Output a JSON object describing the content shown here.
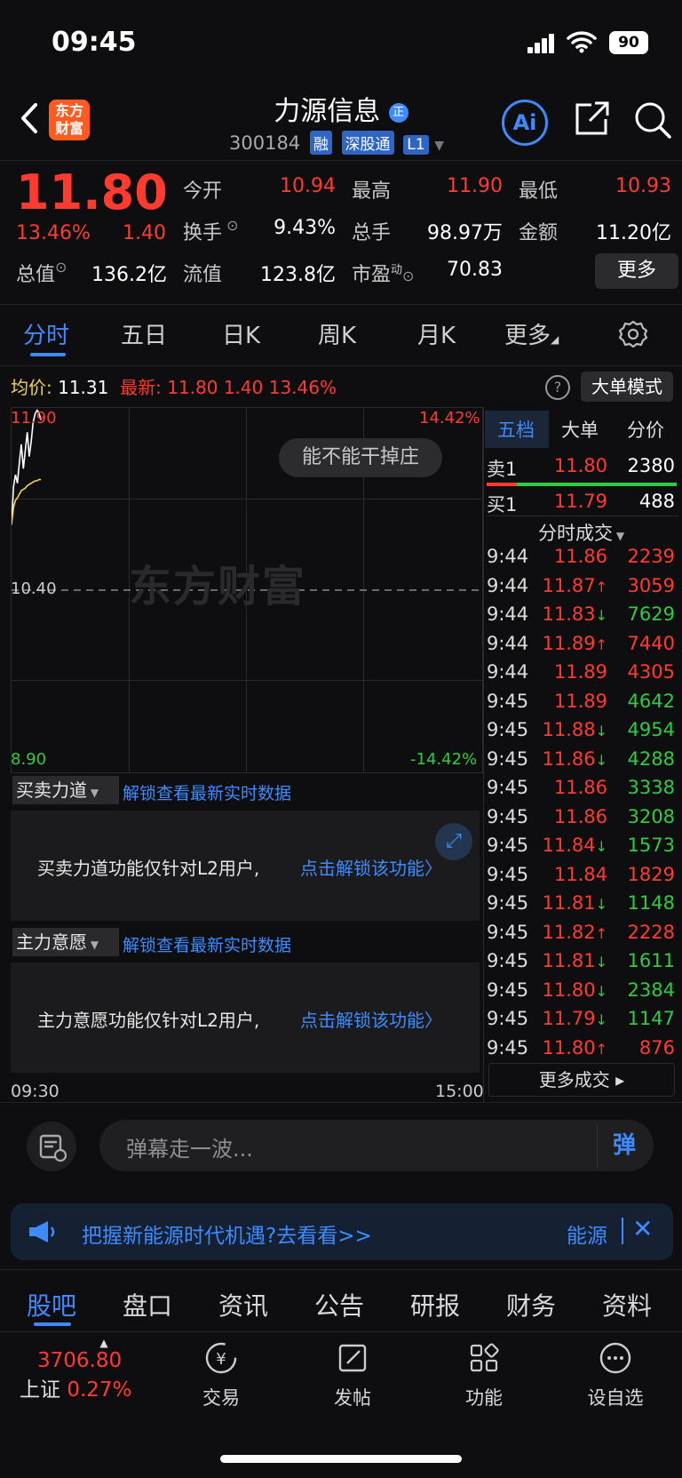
{
  "status_bar": {
    "time": "09:45",
    "battery": "90"
  },
  "header": {
    "logo_line1": "东方",
    "logo_line2": "财富",
    "stock_name": "力源信息",
    "code": "300184",
    "tags": [
      "融",
      "深股通",
      "L1"
    ],
    "ai_label": "Ai"
  },
  "quote": {
    "price": "11.80",
    "change_pct": "13.46%",
    "change": "1.40",
    "open_label": "今开",
    "open": "10.94",
    "high_label": "最高",
    "high": "11.90",
    "low_label": "最低",
    "low": "10.93",
    "turnover_label": "换手",
    "turnover": "9.43%",
    "volume_label": "总手",
    "volume": "98.97万",
    "amount_label": "金额",
    "amount": "11.20亿",
    "mktcap_label": "总值",
    "mktcap": "136.2亿",
    "float_label": "流值",
    "float": "123.8亿",
    "pe_label": "市盈",
    "pe_sup": "动",
    "pe": "70.83",
    "more": "更多"
  },
  "tabs": [
    "分时",
    "五日",
    "日K",
    "周K",
    "月K",
    "更多"
  ],
  "chart_info": {
    "avg_label": "均价:",
    "avg": "11.31",
    "latest_label": "最新:",
    "latest": "11.80",
    "latest_chg": "1.40",
    "latest_pct": "13.46%",
    "mode_button": "大单模式"
  },
  "chart": {
    "top_price": "11.90",
    "top_pct": "14.42%",
    "mid_price": "10.40",
    "bottom_price": "8.90",
    "bottom_pct": "-14.42%",
    "watermark": "东方财富",
    "bubble": "能不能干掉庄",
    "time_start": "09:30",
    "time_end": "15:00"
  },
  "chart_data": {
    "type": "line",
    "x": [
      "09:30",
      "09:31",
      "09:32",
      "09:33",
      "09:34",
      "09:35",
      "09:36",
      "09:37",
      "09:38",
      "09:39",
      "09:40",
      "09:41",
      "09:42",
      "09:43",
      "09:44",
      "09:45"
    ],
    "series": [
      {
        "name": "price",
        "values": [
          10.94,
          11.25,
          11.35,
          11.28,
          11.45,
          11.6,
          11.4,
          11.55,
          11.7,
          11.5,
          11.62,
          11.78,
          11.85,
          11.88,
          11.86,
          11.8
        ]
      },
      {
        "name": "avg",
        "values": [
          10.94,
          11.08,
          11.14,
          11.16,
          11.19,
          11.22,
          11.23,
          11.24,
          11.26,
          11.27,
          11.28,
          11.29,
          11.3,
          11.3,
          11.31,
          11.31
        ]
      }
    ],
    "ylim": [
      8.9,
      11.9
    ],
    "xlim": [
      "09:30",
      "15:00"
    ]
  },
  "order_book": {
    "tabs": [
      "五档",
      "大单",
      "分价"
    ],
    "sell1_label": "卖1",
    "sell1_price": "11.80",
    "sell1_vol": "2380",
    "buy1_label": "买1",
    "buy1_price": "11.79",
    "buy1_vol": "488",
    "trades_title": "分时成交",
    "trades": [
      {
        "t": "9:44",
        "p": "11.86",
        "a": "",
        "v": "2239",
        "vc": "red"
      },
      {
        "t": "9:44",
        "p": "11.87",
        "a": "↑",
        "v": "3059",
        "vc": "red"
      },
      {
        "t": "9:44",
        "p": "11.83",
        "a": "↓",
        "v": "7629",
        "vc": "green"
      },
      {
        "t": "9:44",
        "p": "11.89",
        "a": "↑",
        "v": "7440",
        "vc": "red"
      },
      {
        "t": "9:44",
        "p": "11.89",
        "a": "",
        "v": "4305",
        "vc": "red"
      },
      {
        "t": "9:45",
        "p": "11.89",
        "a": "",
        "v": "4642",
        "vc": "green"
      },
      {
        "t": "9:45",
        "p": "11.88",
        "a": "↓",
        "v": "4954",
        "vc": "green"
      },
      {
        "t": "9:45",
        "p": "11.86",
        "a": "↓",
        "v": "4288",
        "vc": "green"
      },
      {
        "t": "9:45",
        "p": "11.86",
        "a": "",
        "v": "3338",
        "vc": "green"
      },
      {
        "t": "9:45",
        "p": "11.86",
        "a": "",
        "v": "3208",
        "vc": "green"
      },
      {
        "t": "9:45",
        "p": "11.84",
        "a": "↓",
        "v": "1573",
        "vc": "green"
      },
      {
        "t": "9:45",
        "p": "11.84",
        "a": "",
        "v": "1829",
        "vc": "red"
      },
      {
        "t": "9:45",
        "p": "11.81",
        "a": "↓",
        "v": "1148",
        "vc": "green"
      },
      {
        "t": "9:45",
        "p": "11.82",
        "a": "↑",
        "v": "2228",
        "vc": "red"
      },
      {
        "t": "9:45",
        "p": "11.81",
        "a": "↓",
        "v": "1611",
        "vc": "green"
      },
      {
        "t": "9:45",
        "p": "11.80",
        "a": "↓",
        "v": "2384",
        "vc": "green"
      },
      {
        "t": "9:45",
        "p": "11.79",
        "a": "↓",
        "v": "1147",
        "vc": "green"
      },
      {
        "t": "9:45",
        "p": "11.80",
        "a": "↑",
        "v": "876",
        "vc": "red"
      }
    ],
    "more_trades": "更多成交"
  },
  "panels": {
    "p1_title": "买卖力道",
    "p1_link": "解锁查看最新实时数据",
    "p1_msg": "买卖力道功能仅针对L2用户,",
    "p1_cta": "点击解锁该功能",
    "p2_title": "主力意愿",
    "p2_link": "解锁查看最新实时数据",
    "p2_msg": "主力意愿功能仅针对L2用户,",
    "p2_cta": "点击解锁该功能"
  },
  "comment": {
    "placeholder": "弹幕走一波...",
    "send_label": "弹"
  },
  "notice": {
    "text": "把握新能源时代机遇?去看看>>",
    "tag": "能源"
  },
  "bottom_tabs": [
    "股吧",
    "盘口",
    "资讯",
    "公告",
    "研报",
    "财务",
    "资料"
  ],
  "nav": {
    "index_value": "3706.80",
    "index_name": "上证",
    "index_pct": "0.27%",
    "items": [
      "交易",
      "发帖",
      "功能",
      "设自选"
    ]
  },
  "colors": {
    "up": "#ff3b30",
    "down": "#2ecc40",
    "accent": "#3d8bff",
    "avg_line": "#f5d547"
  }
}
